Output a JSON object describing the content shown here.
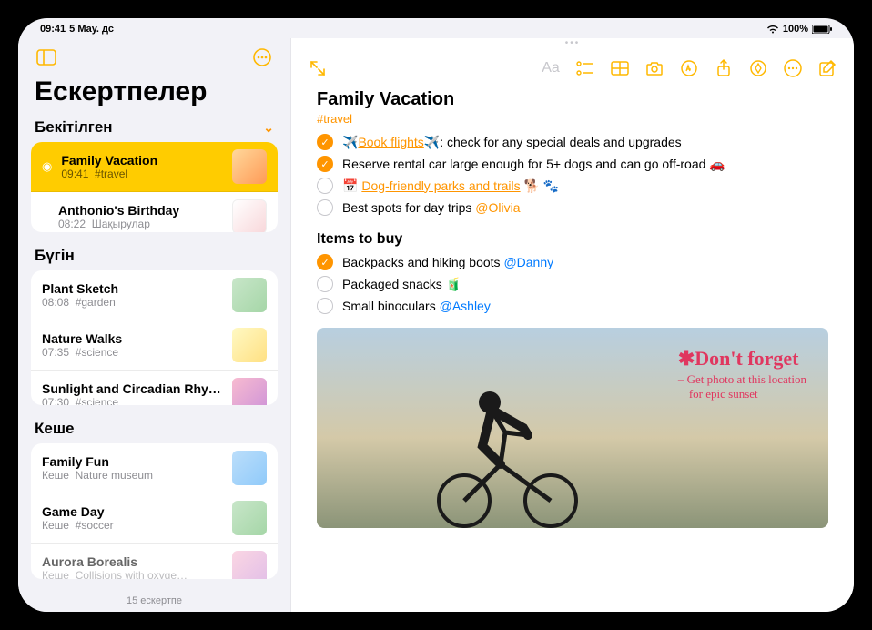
{
  "status": {
    "time": "09:41",
    "date": "5 Мау. дс",
    "wifi": "wifi-icon",
    "battery_pct": "100%"
  },
  "sidebar": {
    "title": "Ескертпелер",
    "sections": {
      "pinned": {
        "label": "Бекітілген",
        "items": [
          {
            "title": "Family Vacation",
            "time": "09:41",
            "sub": "#travel"
          },
          {
            "title": "Anthonio's Birthday",
            "time": "08:22",
            "sub": "Шақырулар"
          }
        ]
      },
      "today": {
        "label": "Бүгін",
        "items": [
          {
            "title": "Plant Sketch",
            "time": "08:08",
            "sub": "#garden"
          },
          {
            "title": "Nature Walks",
            "time": "07:35",
            "sub": "#science"
          },
          {
            "title": "Sunlight and Circadian Rhy…",
            "time": "07:30",
            "sub": "#science"
          }
        ]
      },
      "yesterday": {
        "label": "Кеше",
        "items": [
          {
            "title": "Family Fun",
            "time": "Кеше",
            "sub": "Nature museum"
          },
          {
            "title": "Game Day",
            "time": "Кеше",
            "sub": "#soccer"
          },
          {
            "title": "Aurora Borealis",
            "time": "Кеше",
            "sub": "Collisions with oxyge…"
          }
        ]
      }
    },
    "footer": "15 ескертпе"
  },
  "note": {
    "title": "Family Vacation",
    "tag": "#travel",
    "checklist1": [
      {
        "done": true,
        "pre_emoji": "✈️",
        "link": "Book flights",
        "post_emoji": "✈️",
        "text": ": check for any special deals and upgrades"
      },
      {
        "done": true,
        "text": "Reserve rental car large enough for 5+ dogs and can go off-road 🚗"
      },
      {
        "done": false,
        "cal_emoji": "📅",
        "link": "Dog-friendly parks and trails",
        "post_emoji": "🐕 🐾"
      },
      {
        "done": false,
        "text": "Best spots for day trips ",
        "mention": "@Olivia"
      }
    ],
    "subheading": "Items to buy",
    "checklist2": [
      {
        "done": true,
        "text": "Backpacks and hiking boots ",
        "mention_blue": "@Danny"
      },
      {
        "done": false,
        "text": "Packaged snacks 🧃"
      },
      {
        "done": false,
        "text": "Small binoculars ",
        "mention_blue": "@Ashley"
      }
    ],
    "handwriting": {
      "line1": "✱Don't forget",
      "line2": "– Get photo at this location",
      "line3": "for epic sunset"
    }
  },
  "colors": {
    "accent": "#ffb800",
    "accent_orange": "#ff9500",
    "link_blue": "#007aff"
  }
}
